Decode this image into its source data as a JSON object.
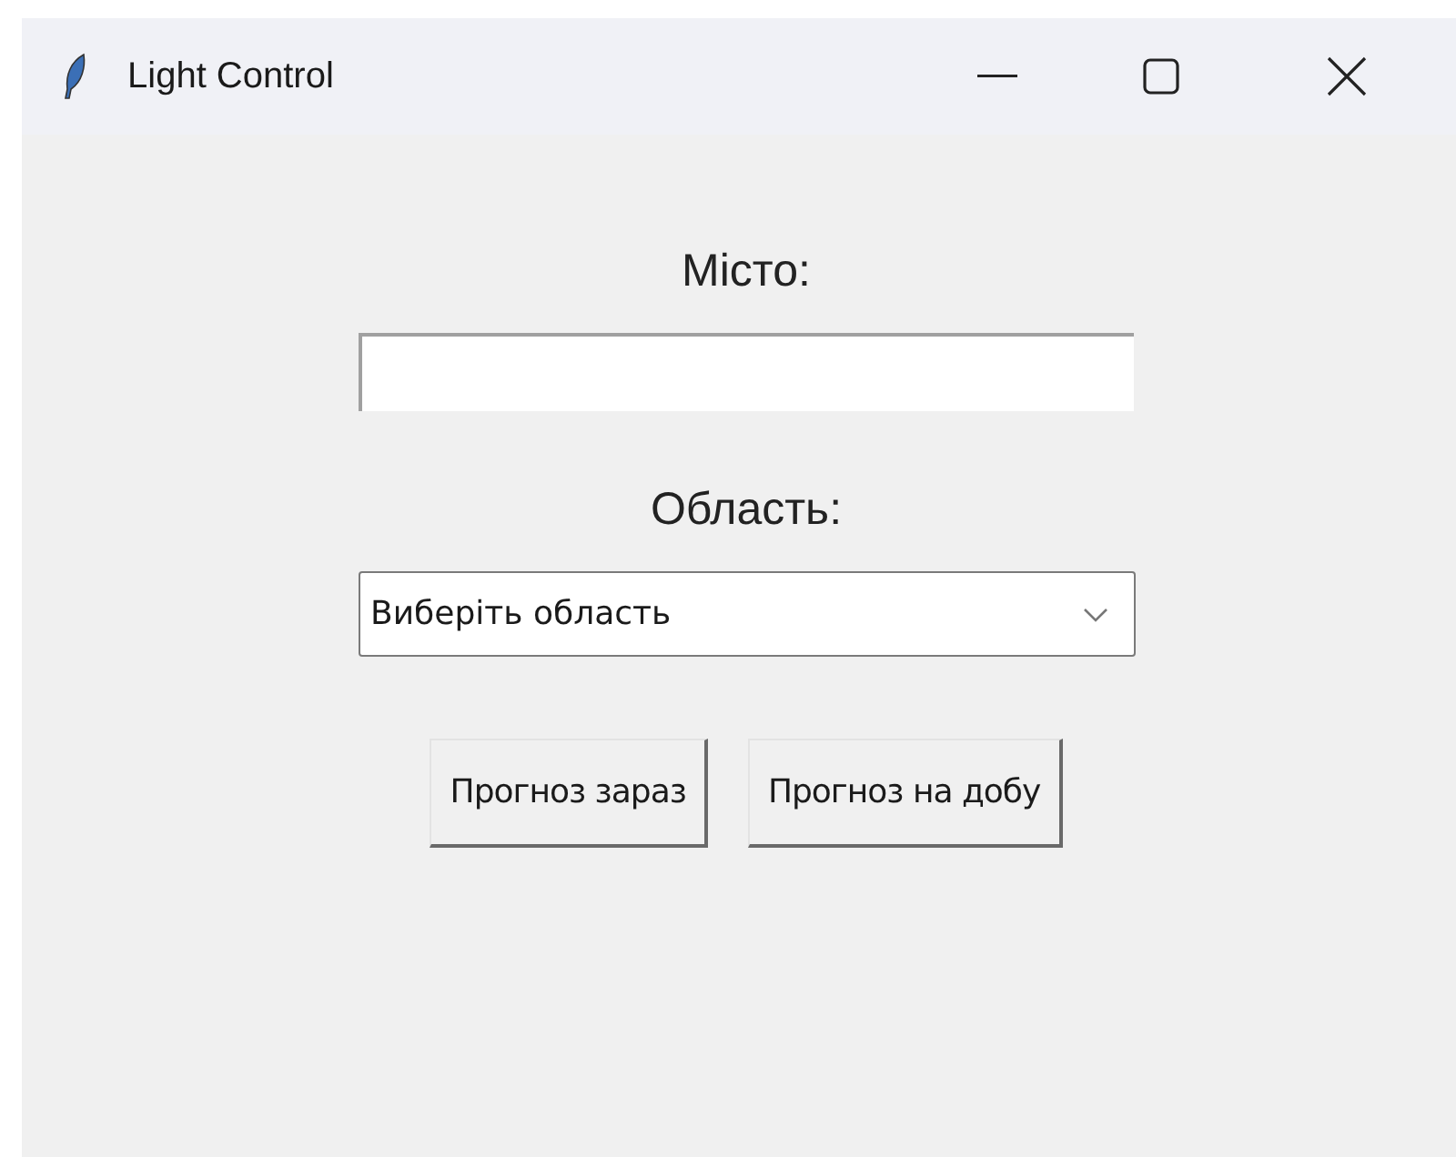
{
  "window": {
    "title": "Light Control"
  },
  "city": {
    "label": "Місто:"
  },
  "region": {
    "label": "Область:",
    "value": "Виберіть область"
  },
  "buttons": [
    "Прогноз зараз",
    "Прогноз на добу"
  ]
}
